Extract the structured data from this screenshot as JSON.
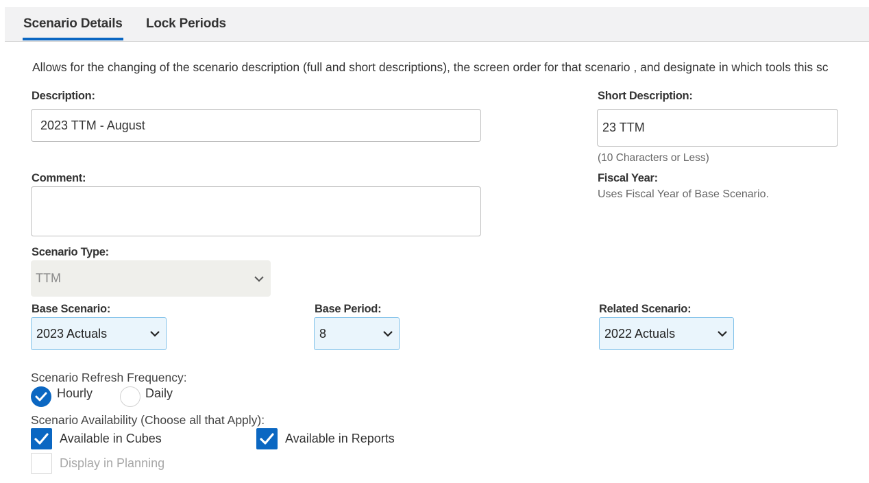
{
  "tabs": [
    {
      "label": "Scenario Details",
      "active": true
    },
    {
      "label": "Lock Periods",
      "active": false
    }
  ],
  "intro_text": "Allows for the changing of the scenario description (full and short descriptions), the screen order for that scenario , and designate in which tools this sc",
  "description": {
    "label": "Description:",
    "value": "2023 TTM - August"
  },
  "short_description": {
    "label": "Short Description:",
    "value": "23 TTM",
    "hint": "(10 Characters or Less)"
  },
  "comment": {
    "label": "Comment:",
    "value": ""
  },
  "fiscal_year": {
    "label": "Fiscal Year:",
    "note": "Uses Fiscal Year of Base Scenario."
  },
  "scenario_type": {
    "label": "Scenario Type:",
    "value": "TTM",
    "disabled": true
  },
  "base_scenario": {
    "label": "Base Scenario:",
    "value": "2023 Actuals"
  },
  "base_period": {
    "label": "Base Period:",
    "value": "8"
  },
  "related_scenario": {
    "label": "Related Scenario:",
    "value": "2022 Actuals"
  },
  "refresh_frequency": {
    "label": "Scenario Refresh Frequency:",
    "options": [
      {
        "label": "Hourly",
        "selected": true
      },
      {
        "label": "Daily",
        "selected": false
      }
    ]
  },
  "availability": {
    "label": "Scenario Availability (Choose all that Apply):",
    "options": [
      {
        "label": "Available in Cubes",
        "checked": true,
        "disabled": false
      },
      {
        "label": "Available in Reports",
        "checked": true,
        "disabled": false
      },
      {
        "label": "Display in Planning",
        "checked": false,
        "disabled": true
      }
    ]
  },
  "colors": {
    "accent": "#0b67c2",
    "select_bg": "#eaf5fc",
    "select_border": "#82c2ea",
    "disabled_bg": "#efefeb"
  },
  "icons": {
    "dropdown": "chevron-down-icon",
    "radio_checked": "check-icon",
    "checkbox_checked": "check-icon"
  }
}
